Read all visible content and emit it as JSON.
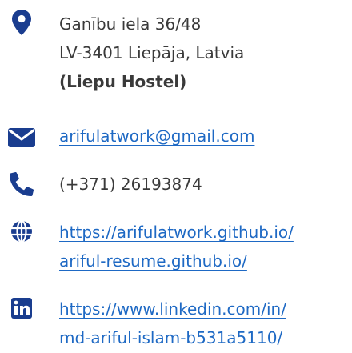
{
  "address": {
    "icon": "map-pin-icon",
    "line1": "Ganību iela 36/48",
    "line2": "LV-3401 Liepāja, Latvia",
    "line3": "(Liepu Hostel)"
  },
  "email": {
    "icon": "envelope-icon",
    "text": "arifulatwork@gmail.com"
  },
  "phone": {
    "icon": "phone-icon",
    "text": "(+371) 26193874"
  },
  "website": {
    "icon": "globe-icon",
    "line1": "https://arifulatwork.github.io/",
    "line2": "ariful-resume.github.io/"
  },
  "linkedin": {
    "icon": "linkedin-icon",
    "line1": "https://www.linkedin.com/in/",
    "line2": "md-ariful-islam-b531a5110/"
  },
  "colors": {
    "icon": "#1a3d8f",
    "link": "#1e69c4",
    "text": "#3a3a3a"
  }
}
